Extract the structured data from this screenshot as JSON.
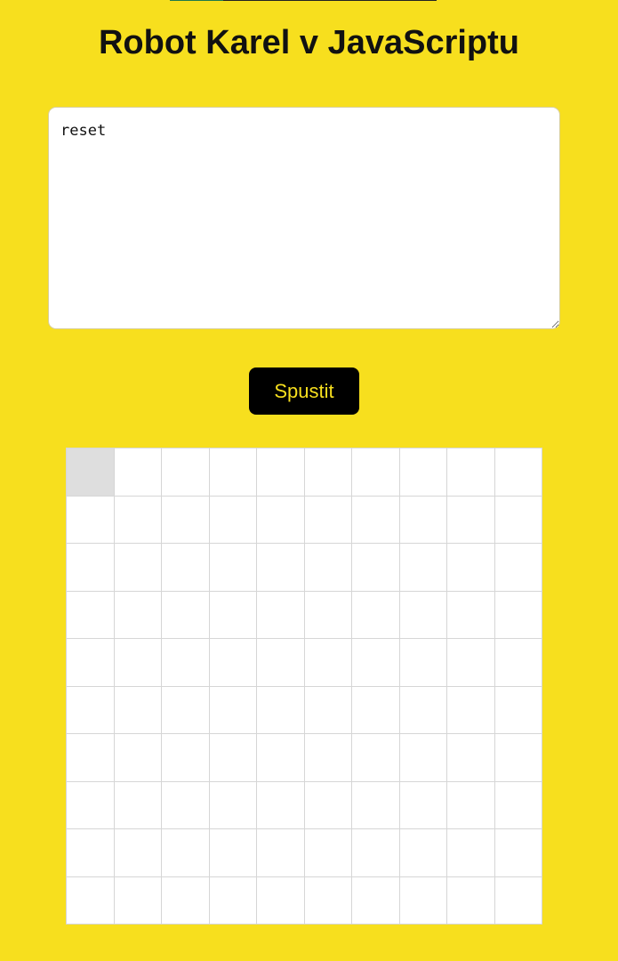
{
  "page": {
    "title": "Robot Karel v JavaScriptu",
    "background_color": "#f7df1e"
  },
  "editor": {
    "value": "reset"
  },
  "run_button": {
    "label": "Spustit",
    "background_color": "#000000",
    "text_color": "#f7df1e"
  },
  "board": {
    "rows": 10,
    "columns": 10,
    "robot_position": {
      "row": 0,
      "column": 0
    },
    "robot_cell_color": "#dedede",
    "cell_color": "#ffffff",
    "grid_line_color": "#d6d6d6"
  }
}
